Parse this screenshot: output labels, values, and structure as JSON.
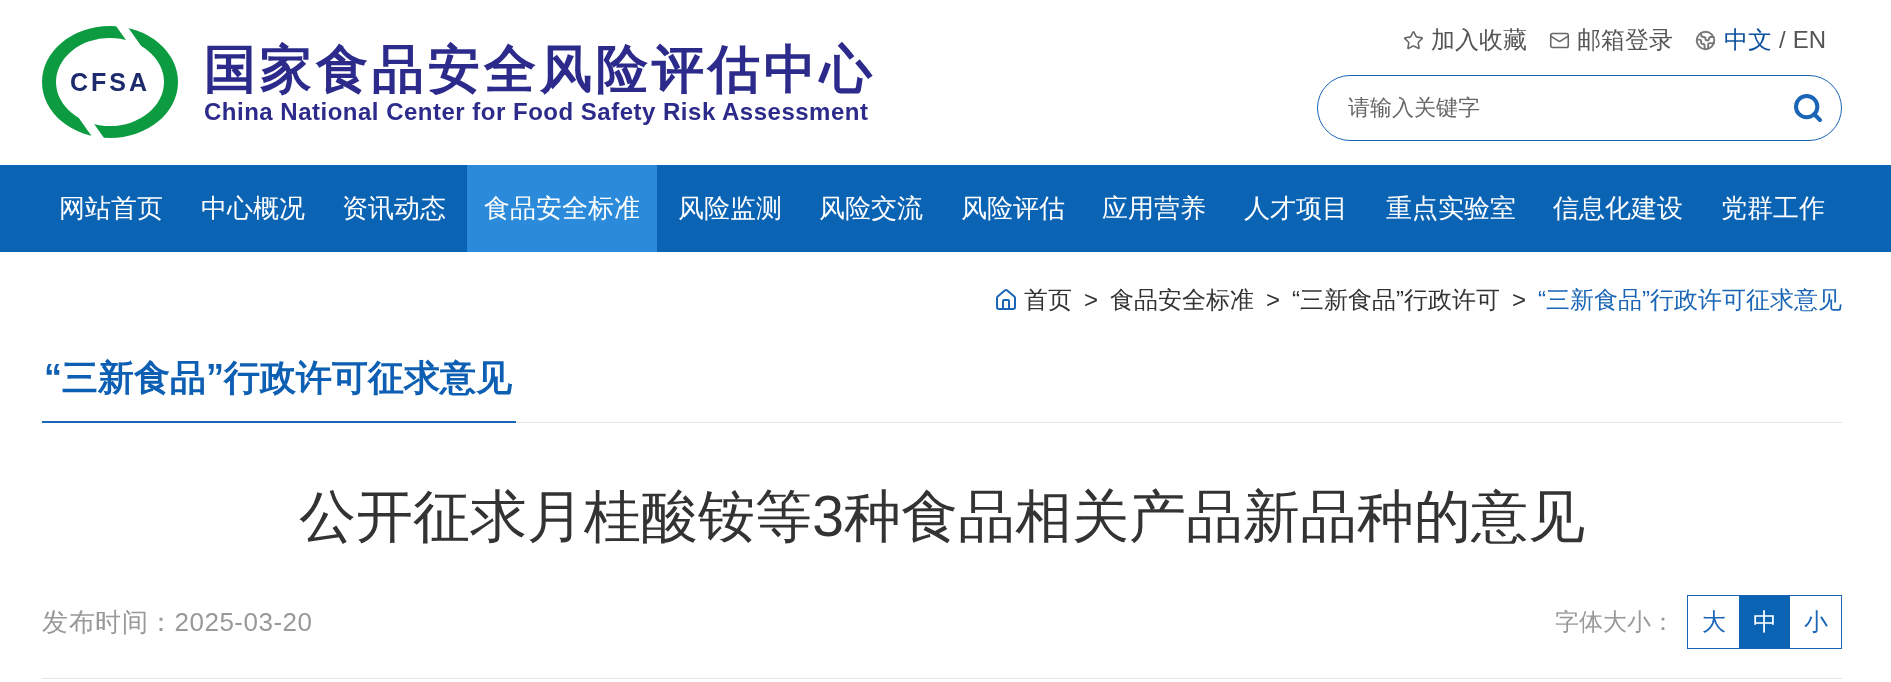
{
  "header": {
    "logo_badge": "CFSA",
    "title": "国家食品安全风险评估中心",
    "subtitle": "China National Center for Food Safety Risk Assessment"
  },
  "top_links": [
    {
      "kind": "favorite",
      "label": "加入收藏"
    },
    {
      "kind": "mail",
      "label": "邮箱登录"
    }
  ],
  "language": {
    "options": [
      {
        "label": "中文",
        "selected": true
      },
      {
        "label": "EN",
        "selected": false
      }
    ],
    "separator": "/"
  },
  "search": {
    "placeholder": "请输入关键字"
  },
  "nav": [
    {
      "label": "网站首页",
      "selected": false
    },
    {
      "label": "中心概况",
      "selected": false
    },
    {
      "label": "资讯动态",
      "selected": false
    },
    {
      "label": "食品安全标准",
      "selected": true
    },
    {
      "label": "风险监测",
      "selected": false
    },
    {
      "label": "风险交流",
      "selected": false
    },
    {
      "label": "风险评估",
      "selected": false
    },
    {
      "label": "应用营养",
      "selected": false
    },
    {
      "label": "人才项目",
      "selected": false
    },
    {
      "label": "重点实验室",
      "selected": false
    },
    {
      "label": "信息化建设",
      "selected": false
    },
    {
      "label": "党群工作",
      "selected": false
    }
  ],
  "breadcrumb": [
    {
      "label": "首页",
      "current": false,
      "separator": ">"
    },
    {
      "label": "食品安全标准",
      "current": false,
      "separator": ">"
    },
    {
      "label": "“三新食品”行政许可",
      "current": false,
      "separator": ">"
    },
    {
      "label": "“三新食品”行政许可征求意见",
      "current": true
    }
  ],
  "section_title": "“三新食品”行政许可征求意见",
  "article": {
    "title": "公开征求月桂酸铵等3种食品相关产品新品种的意见",
    "published": "发布时间：2025-03-20"
  },
  "font_size": {
    "label": "字体大小：",
    "options": [
      {
        "label": "大",
        "selected": false
      },
      {
        "label": "中",
        "selected": true
      },
      {
        "label": "小",
        "selected": false
      }
    ]
  }
}
